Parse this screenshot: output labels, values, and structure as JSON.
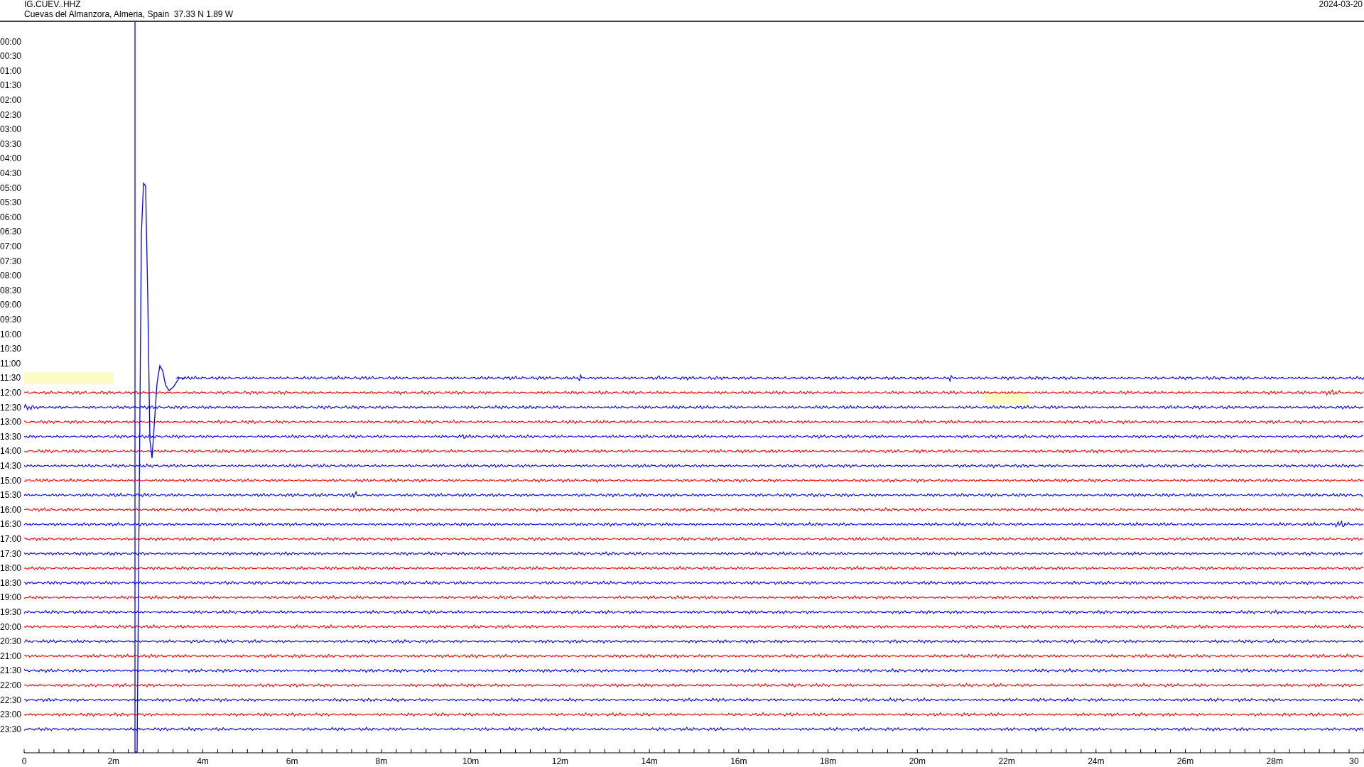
{
  "header": {
    "station": "IG.CUEV..HHZ",
    "location": "Cuevas del Almanzora, Almeria, Spain  37.33 N 1.89 W",
    "date": "2024-03-20"
  },
  "rows": [
    {
      "time": "00:00"
    },
    {
      "time": "00:30"
    },
    {
      "time": "01:00"
    },
    {
      "time": "01:30"
    },
    {
      "time": "02:00"
    },
    {
      "time": "02:30"
    },
    {
      "time": "03:00"
    },
    {
      "time": "03:30"
    },
    {
      "time": "04:00"
    },
    {
      "time": "04:30"
    },
    {
      "time": "05:00"
    },
    {
      "time": "05:30"
    },
    {
      "time": "06:00"
    },
    {
      "time": "06:30"
    },
    {
      "time": "07:00"
    },
    {
      "time": "07:30"
    },
    {
      "time": "08:00"
    },
    {
      "time": "08:30"
    },
    {
      "time": "09:00"
    },
    {
      "time": "09:30"
    },
    {
      "time": "10:00"
    },
    {
      "time": "10:30"
    },
    {
      "time": "11:00"
    },
    {
      "time": "11:30",
      "color": "#0000ff"
    },
    {
      "time": "12:00",
      "color": "#ff0000"
    },
    {
      "time": "12:30",
      "color": "#0000ff"
    },
    {
      "time": "13:00",
      "color": "#ff0000"
    },
    {
      "time": "13:30",
      "color": "#0000ff"
    },
    {
      "time": "14:00",
      "color": "#ff0000"
    },
    {
      "time": "14:30",
      "color": "#0000ff"
    },
    {
      "time": "15:00",
      "color": "#ff0000"
    },
    {
      "time": "15:30",
      "color": "#0000ff"
    },
    {
      "time": "16:00",
      "color": "#ff0000"
    },
    {
      "time": "16:30",
      "color": "#0000ff"
    },
    {
      "time": "17:00",
      "color": "#ff0000"
    },
    {
      "time": "17:30",
      "color": "#0000ff"
    },
    {
      "time": "18:00",
      "color": "#ff0000"
    },
    {
      "time": "18:30",
      "color": "#0000ff"
    },
    {
      "time": "19:00",
      "color": "#ff0000"
    },
    {
      "time": "19:30",
      "color": "#0000ff"
    },
    {
      "time": "20:00",
      "color": "#ff0000"
    },
    {
      "time": "20:30",
      "color": "#0000ff"
    },
    {
      "time": "21:00",
      "color": "#ff0000"
    },
    {
      "time": "21:30",
      "color": "#0000ff"
    },
    {
      "time": "22:00",
      "color": "#ff0000"
    },
    {
      "time": "22:30",
      "color": "#0000ff"
    },
    {
      "time": "23:00",
      "color": "#ff0000"
    },
    {
      "time": "23:30",
      "color": "#0000ff"
    }
  ],
  "x_axis": {
    "labels": [
      "0",
      "2m",
      "4m",
      "6m",
      "8m",
      "10m",
      "12m",
      "14m",
      "16m",
      "18m",
      "20m",
      "22m",
      "24m",
      "26m",
      "28m",
      "30"
    ]
  }
}
